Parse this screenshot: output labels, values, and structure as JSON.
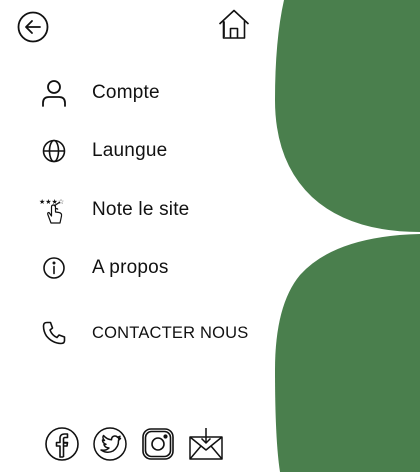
{
  "theme": {
    "accent": "#4a7f4d",
    "text": "#111111",
    "background": "#ffffff"
  },
  "header": {
    "back_icon": "back-arrow-circle-icon",
    "home_icon": "home-icon"
  },
  "menu": {
    "items": [
      {
        "id": "account",
        "icon": "user-icon",
        "label": "Compte"
      },
      {
        "id": "language",
        "icon": "globe-icon",
        "label": "Laungue"
      },
      {
        "id": "rate",
        "icon": "rate-stars-hand-icon",
        "label": "Note le site"
      },
      {
        "id": "about",
        "icon": "info-icon",
        "label": "A propos"
      },
      {
        "id": "contact",
        "icon": "phone-icon",
        "label": "CONTACTER NOUS"
      }
    ]
  },
  "social": {
    "items": [
      {
        "id": "facebook",
        "icon": "facebook-icon"
      },
      {
        "id": "twitter",
        "icon": "twitter-icon"
      },
      {
        "id": "instagram",
        "icon": "instagram-icon"
      },
      {
        "id": "mail",
        "icon": "mail-download-icon"
      }
    ]
  }
}
